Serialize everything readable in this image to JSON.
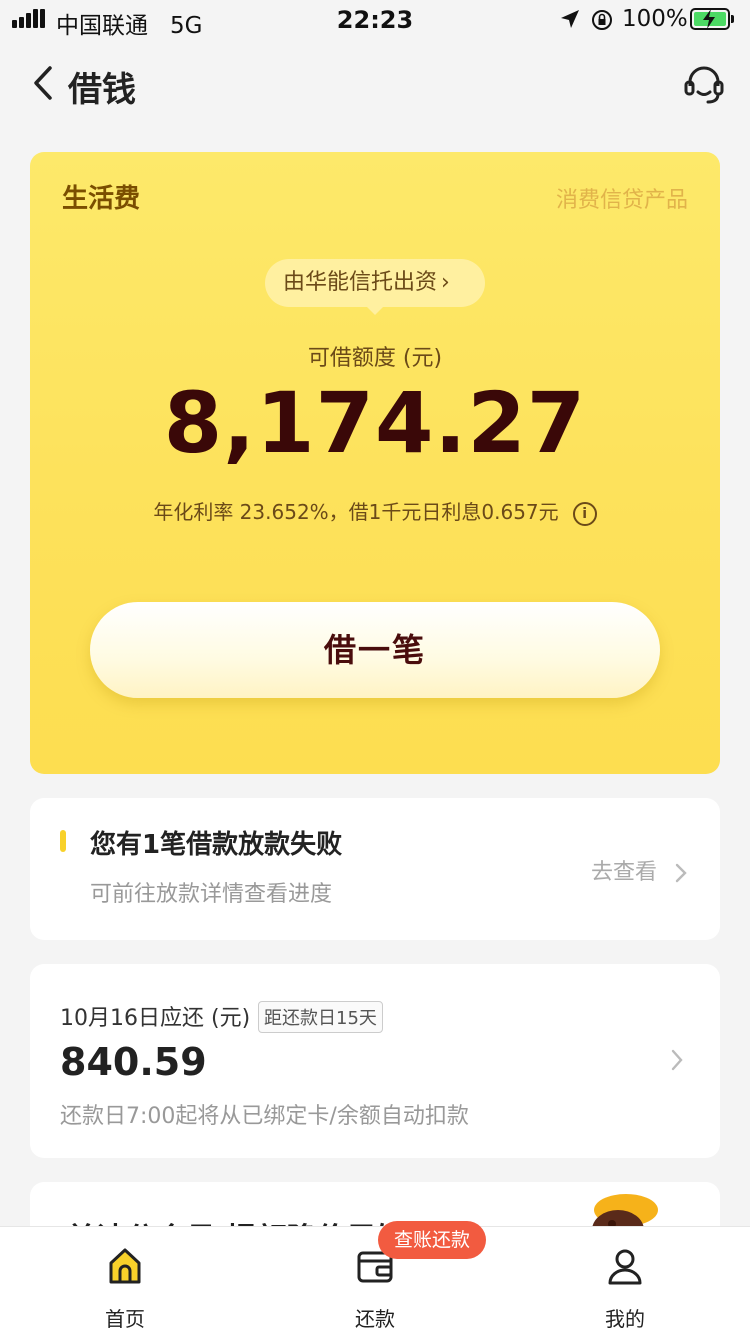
{
  "status_bar": {
    "carrier": "中国联通",
    "network": "5G",
    "time": "22:23",
    "battery": "100%"
  },
  "nav": {
    "title": "借钱",
    "back_icon": "chevron-left-icon",
    "service_icon": "headset-icon"
  },
  "credit_card": {
    "product_name": "生活费",
    "product_tag": "消费信贷产品",
    "funder": "由华能信托出资",
    "limit_label": "可借额度 (元)",
    "limit_amount": "8,174.27",
    "rate_text": "年化利率 23.652%，借1千元日利息0.657元",
    "borrow_button": "借一笔",
    "colors": {
      "card": "#fde15a",
      "amount": "#3a0808"
    }
  },
  "notice_card": {
    "title": "您有1笔借款放款失败",
    "subtitle": "可前往放款详情查看进度",
    "link": "去查看"
  },
  "repay_card": {
    "label": "10月16日应还 (元)",
    "badge": "距还款日15天",
    "amount": "840.59",
    "subtitle": "还款日7:00起将从已绑定卡/余额自动扣款"
  },
  "promo_card": {
    "title": "单读分会员 提额降价早知道"
  },
  "tab_bar": {
    "items": [
      {
        "label": "首页",
        "icon": "home-icon",
        "active": true
      },
      {
        "label": "还款",
        "icon": "wallet-icon",
        "active": false
      },
      {
        "label": "我的",
        "icon": "person-icon",
        "active": false
      }
    ],
    "badge": "查账还款",
    "badge_color": "#f25b40"
  }
}
